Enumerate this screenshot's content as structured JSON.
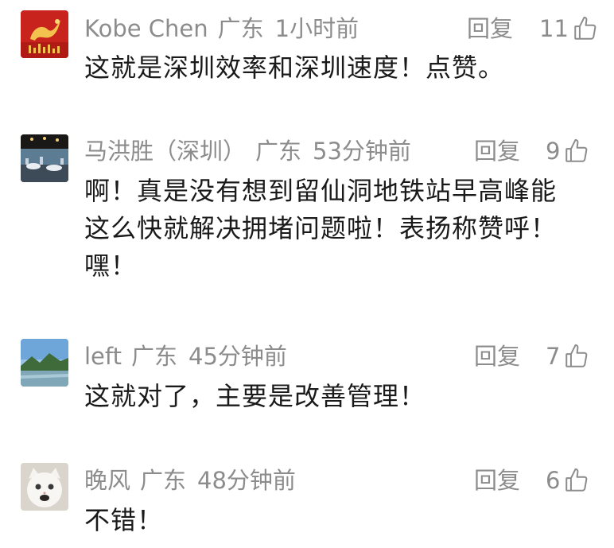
{
  "comments": [
    {
      "author": "Kobe Chen",
      "location": "广东",
      "time": "1小时前",
      "reply_label": "回复",
      "likes": "11",
      "text": "这就是深圳效率和深圳速度！点赞。"
    },
    {
      "author": "马洪胜（深圳）",
      "location": "广东",
      "time": "53分钟前",
      "reply_label": "回复",
      "likes": "9",
      "text": "啊！真是没有想到留仙洞地铁站早高峰能这么快就解决拥堵问题啦！表扬称赞呼！嘿！"
    },
    {
      "author": "left",
      "location": "广东",
      "time": "45分钟前",
      "reply_label": "回复",
      "likes": "7",
      "text": "这就对了，主要是改善管理！"
    },
    {
      "author": "晚风",
      "location": "广东",
      "time": "48分钟前",
      "reply_label": "回复",
      "likes": "6",
      "text": "不错！"
    }
  ],
  "icons": {
    "like": "thumbs-up-icon",
    "avatar_1": "red-dragon-avatar",
    "avatar_2": "banquet-hall-avatar",
    "avatar_3": "landscape-avatar",
    "avatar_4": "white-cat-avatar"
  },
  "colors": {
    "meta_text": "#8c8c8c",
    "body_text": "#1a1a1a",
    "background": "#ffffff"
  }
}
